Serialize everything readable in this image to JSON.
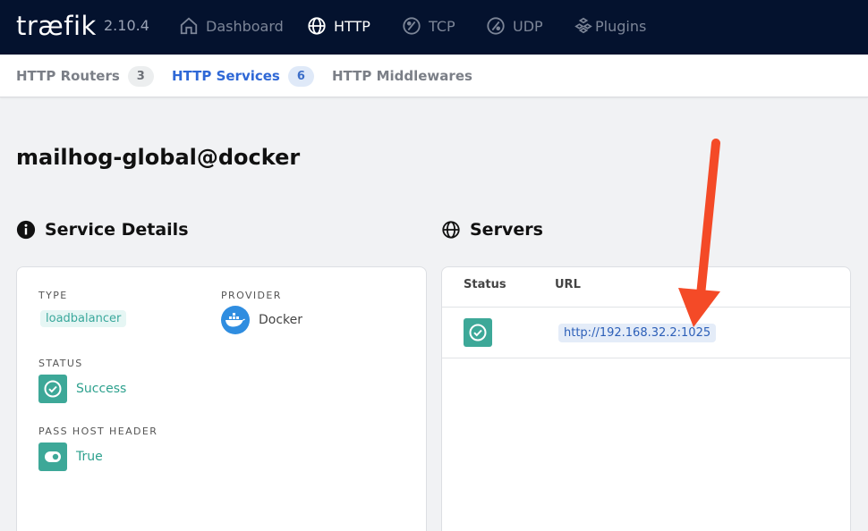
{
  "app": {
    "logo": "træfik",
    "version": "2.10.4"
  },
  "nav": [
    {
      "label": "Dashboard",
      "icon": "home-icon"
    },
    {
      "label": "HTTP",
      "icon": "globe-icon"
    },
    {
      "label": "TCP",
      "icon": "tcp-icon"
    },
    {
      "label": "UDP",
      "icon": "udp-icon"
    },
    {
      "label": "Plugins",
      "icon": "plugins-icon"
    }
  ],
  "subnav": [
    {
      "label": "HTTP Routers",
      "count": "3"
    },
    {
      "label": "HTTP Services",
      "count": "6"
    },
    {
      "label": "HTTP Middlewares"
    }
  ],
  "page": {
    "title": "mailhog-global@docker"
  },
  "details": {
    "title": "Service Details",
    "type_label": "TYPE",
    "type_value": "loadbalancer",
    "provider_label": "PROVIDER",
    "provider_value": "Docker",
    "status_label": "STATUS",
    "status_value": "Success",
    "passhost_label": "PASS HOST HEADER",
    "passhost_value": "True"
  },
  "servers": {
    "title": "Servers",
    "col_status": "Status",
    "col_url": "URL",
    "rows": [
      {
        "url": "http://192.168.32.2:1025"
      }
    ]
  },
  "colors": {
    "nav_bg": "#04122e",
    "accent": "#2f68d6",
    "success": "#3da898",
    "annotation_arrow": "#f44a27"
  }
}
